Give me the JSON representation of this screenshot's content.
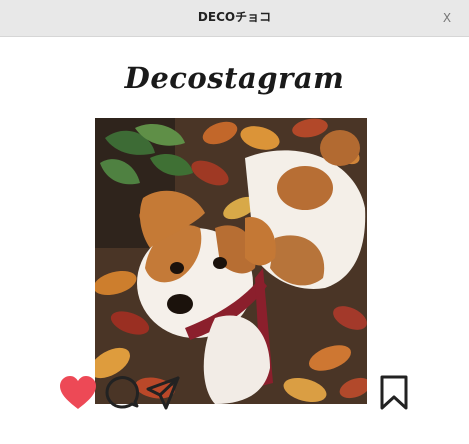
{
  "window": {
    "title": "DECOチョコ",
    "close_label": "X"
  },
  "post": {
    "brand_logo_text": "Decostagram",
    "photo_icon": "dog-photo",
    "liked": true,
    "actions": [
      {
        "name": "heart-icon",
        "state": "liked"
      },
      {
        "name": "comment-icon",
        "state": "default"
      },
      {
        "name": "share-icon",
        "state": "default"
      },
      {
        "name": "bookmark-icon",
        "state": "default"
      }
    ]
  },
  "colors": {
    "titlebar_bg": "#e8e8e8",
    "heart_fill": "#ed4956",
    "icon_stroke": "#222222"
  }
}
